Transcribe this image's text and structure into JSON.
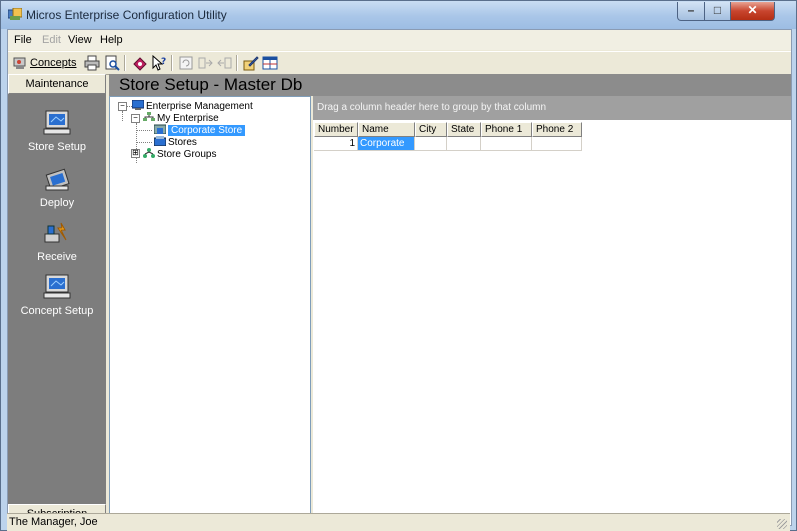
{
  "window": {
    "title": "Micros Enterprise Configuration Utility",
    "min_glyph": "–",
    "max_glyph": "□",
    "close_glyph": "✕"
  },
  "menu": {
    "file": "File",
    "edit": "Edit",
    "view": "View",
    "help": "Help"
  },
  "toolbar": {
    "concepts_label": "Concepts",
    "icons": [
      "concepts-icon",
      "print-icon",
      "print-preview-icon",
      "properties-icon",
      "context-help-icon",
      "refresh-icon",
      "move-right-icon",
      "move-left-icon",
      "edit-icon",
      "split-icon"
    ]
  },
  "sidebar": {
    "header": "Maintenance",
    "footer": "Subscription",
    "items": [
      {
        "label": "Store Setup",
        "icon": "monitor-icon"
      },
      {
        "label": "Deploy",
        "icon": "deploy-icon"
      },
      {
        "label": "Receive",
        "icon": "receive-icon"
      },
      {
        "label": "Concept Setup",
        "icon": "monitor-icon"
      }
    ]
  },
  "content": {
    "title": "Store Setup - Master Db"
  },
  "tree": {
    "root": "Enterprise Management",
    "enterprise": "My Enterprise",
    "corporate": "Corporate Store",
    "stores": "Stores",
    "groups": "Store Groups",
    "expand_glyph": "⊞",
    "collapse_glyph": "−"
  },
  "grid": {
    "group_hint": "Drag a column header here to group by that column",
    "columns": [
      "Number",
      "Name",
      "City",
      "State",
      "Phone 1",
      "Phone 2"
    ],
    "rows": [
      {
        "number": "1",
        "name": "Corporate",
        "city": "",
        "state": "",
        "phone1": "",
        "phone2": ""
      }
    ]
  },
  "status": {
    "user": "The Manager, Joe"
  },
  "colors": {
    "selection": "#3399ff",
    "sidebar_bg": "#7d7d7d",
    "header_bg": "#8c8c8c"
  }
}
